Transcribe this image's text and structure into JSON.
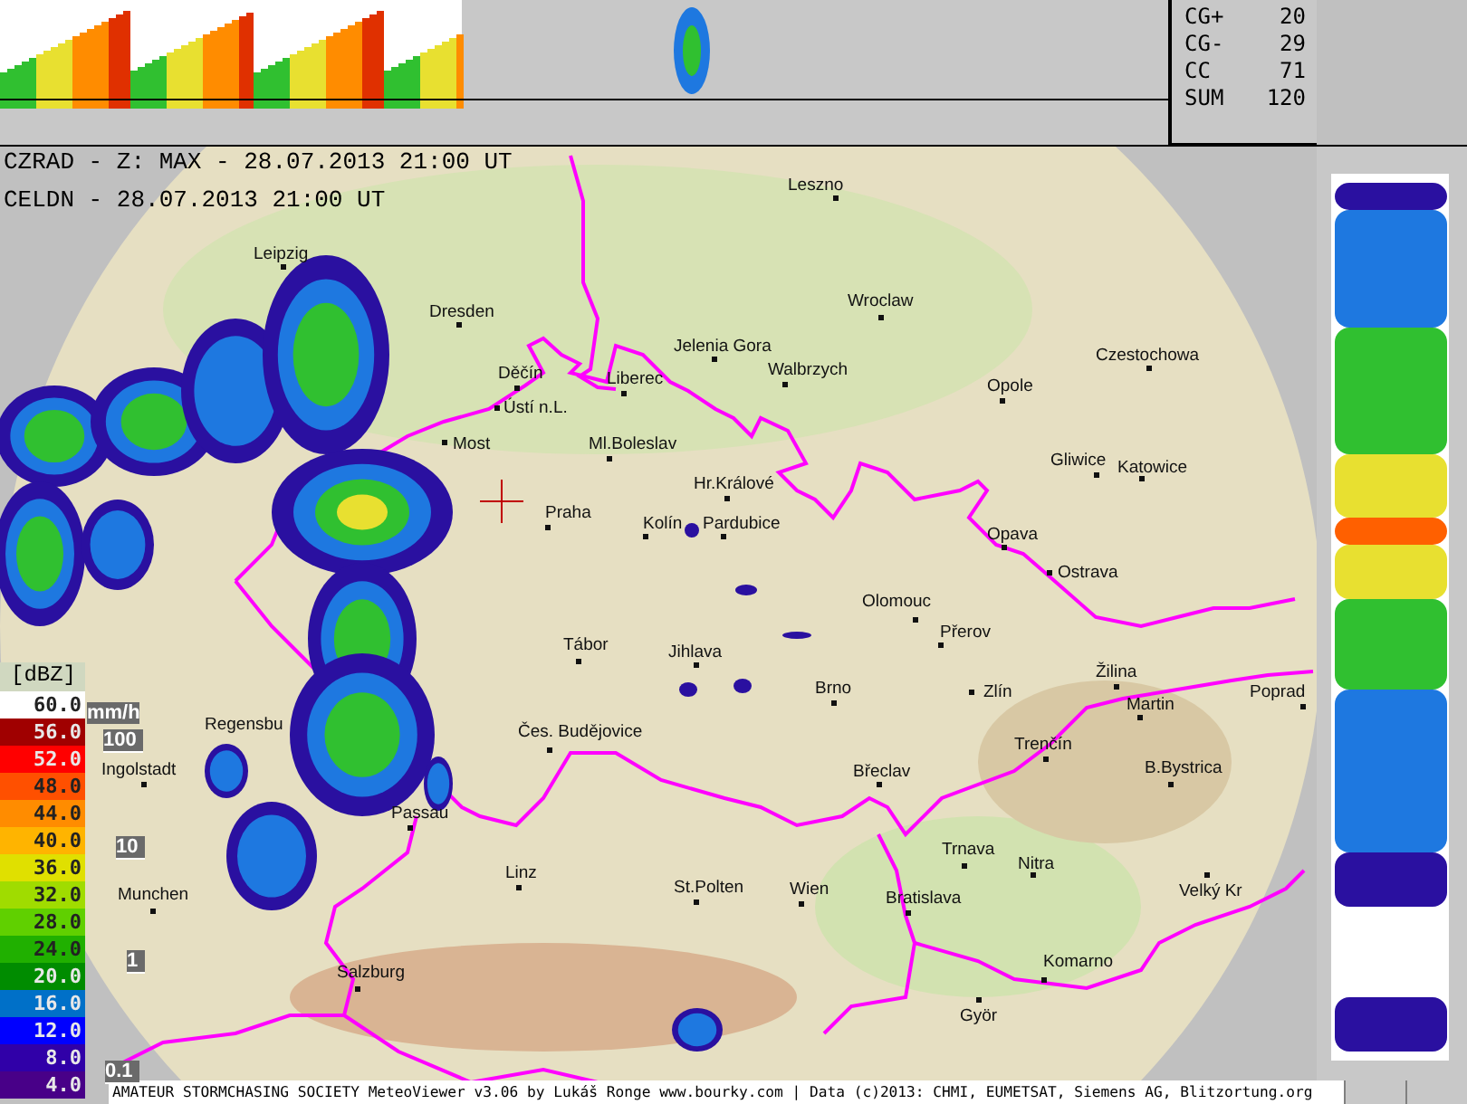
{
  "top_panel": {
    "stats": [
      {
        "label": "CG+",
        "value": "20"
      },
      {
        "label": "CG-",
        "value": "29"
      },
      {
        "label": "CC",
        "value": "71"
      },
      {
        "label": "SUM",
        "value": "120"
      }
    ]
  },
  "map": {
    "header_lines": [
      "CZRAD - Z: MAX - 28.07.2013 21:00 UT",
      "CELDN - 28.07.2013 21:00 UT"
    ],
    "cities": [
      "Leszno",
      "Leipzig",
      "Dresden",
      "Wroclaw",
      "Jelenia Gora",
      "Czestochowa",
      "Děčín",
      "Liberec",
      "Walbrzych",
      "Opole",
      "Ústí n.L.",
      "Most",
      "Ml.Boleslav",
      "Gliwice",
      "Katowice",
      "Hr.Králové",
      "Praha",
      "Kolín",
      "Pardubice",
      "Opava",
      "Ostrava",
      "Olomouc",
      "Přerov",
      "Tábor",
      "Jihlava",
      "Žilina",
      "Brno",
      "Zlín",
      "Poprad",
      "Martin",
      "Regensbu",
      "Čes. Budějovice",
      "Trenčín",
      "Ingolstadt",
      "Břeclav",
      "B.Bystrica",
      "Passau",
      "Trnava",
      "Linz",
      "Nitra",
      "Munchen",
      "St.Polten",
      "Wien",
      "Bratislava",
      "Velký Kr",
      "Salzburg",
      "Komarno",
      "Györ"
    ],
    "rain_scale": {
      "unit": "mm/h",
      "ticks": [
        "100",
        "10",
        "1",
        "0.1"
      ]
    }
  },
  "legend": {
    "unit": "[dBZ]",
    "items": [
      {
        "value": "60.0",
        "color": "#ffffff"
      },
      {
        "value": "56.0",
        "color": "#a00000"
      },
      {
        "value": "52.0",
        "color": "#ff0000"
      },
      {
        "value": "48.0",
        "color": "#ff5000"
      },
      {
        "value": "44.0",
        "color": "#ff8c00"
      },
      {
        "value": "40.0",
        "color": "#ffb400"
      },
      {
        "value": "36.0",
        "color": "#e0e000"
      },
      {
        "value": "32.0",
        "color": "#a0dc00"
      },
      {
        "value": "28.0",
        "color": "#60d000"
      },
      {
        "value": "24.0",
        "color": "#20b000"
      },
      {
        "value": "20.0",
        "color": "#008c00"
      },
      {
        "value": "16.0",
        "color": "#0070c8"
      },
      {
        "value": "12.0",
        "color": "#0000ff"
      },
      {
        "value": "8.0",
        "color": "#3000a8"
      },
      {
        "value": "4.0",
        "color": "#480088"
      }
    ]
  },
  "status_bar": {
    "text": "AMATEUR STORMCHASING SOCIETY MeteoViewer v3.06 by Lukáš Ronge www.bourky.com | Data (c)2013: CHMI, EUMETSAT, Siemens AG, Blitzortung.org"
  }
}
